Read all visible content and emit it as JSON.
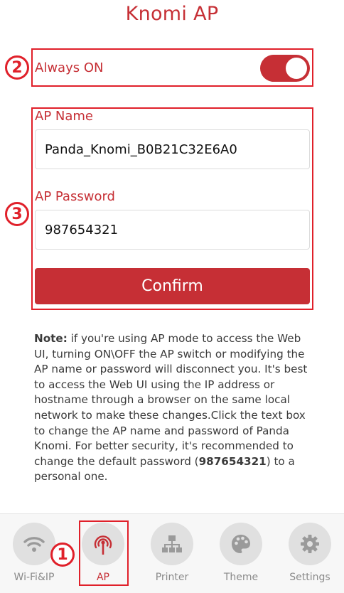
{
  "page": {
    "title": "Knomi AP"
  },
  "always_on": {
    "label": "Always ON",
    "state": "on"
  },
  "ap_name": {
    "label": "AP Name",
    "value": "Panda_Knomi_B0B21C32E6A0"
  },
  "ap_password": {
    "label": "AP Password",
    "value": "987654321"
  },
  "confirm_label": "Confirm",
  "note": {
    "prefix": "Note:",
    "body1": " if you're using AP mode to access the Web UI, turning ON\\OFF the AP switch or modifying the AP name or password will disconnect you. It's best to access the Web UI using the IP address or hostname through a browser on the same local network to make these changes.Click the text box to change the AP name and password of Panda Knomi. For better security, it's recommended to change the default password (",
    "password": "987654321",
    "body2": ") to a personal one."
  },
  "annotations": {
    "n1": "1",
    "n2": "2",
    "n3": "3"
  },
  "nav": {
    "items": [
      {
        "label": "Wi-Fi&IP",
        "icon": "wifi-icon"
      },
      {
        "label": "AP",
        "icon": "ap-broadcast-icon",
        "active": true
      },
      {
        "label": "Printer",
        "icon": "network-icon"
      },
      {
        "label": "Theme",
        "icon": "palette-icon"
      },
      {
        "label": "Settings",
        "icon": "gear-icon"
      }
    ]
  },
  "colors": {
    "accent": "#c62f35",
    "annotation": "#e0202a",
    "nav_inactive": "#8a8a8a"
  }
}
